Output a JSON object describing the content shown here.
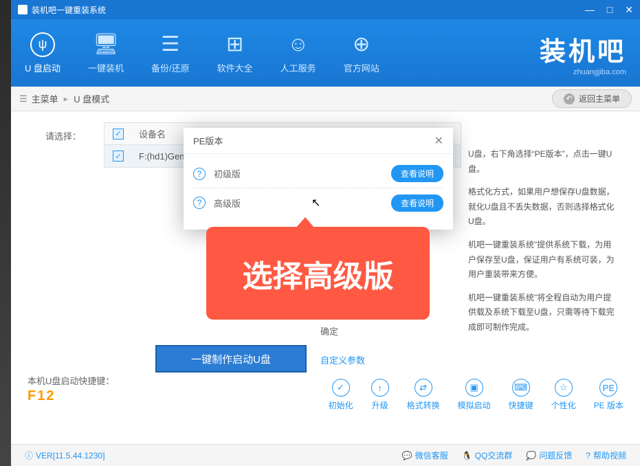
{
  "window": {
    "title": "装机吧一键重装系统"
  },
  "toolbar": {
    "items": [
      {
        "label": "U 盘启动"
      },
      {
        "label": "一键装机"
      },
      {
        "label": "备份/还原"
      },
      {
        "label": "软件大全"
      },
      {
        "label": "人工服务"
      },
      {
        "label": "官方网站"
      }
    ]
  },
  "brand": {
    "text": "装机吧",
    "url": "zhuangjiba.com"
  },
  "breadcrumb": {
    "main": "主菜单",
    "sub": "U 盘模式",
    "back": "返回主菜单"
  },
  "content": {
    "select_label": "请选择：",
    "table_header": "设备名",
    "device_row": "F:(hd1)Genera",
    "info_p1": "U盘，右下角选择“PE版本”，点击一键U盘。",
    "info_p2": "格式化方式，如果用户想保存U盘数据，就化U盘且不丢失数据，否则选择格式化U盘。",
    "info_p3": "机吧一键重装系统\"提供系统下载，为用户保存至U盘，保证用户有系统可装，为用户重装带来方便。",
    "info_p4": "机吧一键重装系统\"将全程自动为用户提供载及系统下载至U盘，只需等待下载完成即可制作完成。",
    "confirm": "确定",
    "make_button": "一键制作启动U盘",
    "custom_link": "自定义参数"
  },
  "modal": {
    "title": "PE版本",
    "option1": "初级版",
    "option2": "高级版",
    "view_btn": "查看说明"
  },
  "callout": {
    "text": "选择高级版"
  },
  "hotkey": {
    "label": "本机U盘启动快捷键：",
    "value": "F12"
  },
  "bottom_tools": {
    "items": [
      {
        "label": "初始化"
      },
      {
        "label": "升级"
      },
      {
        "label": "格式转换"
      },
      {
        "label": "模拟启动"
      },
      {
        "label": "快捷键"
      },
      {
        "label": "个性化"
      },
      {
        "label": "PE 版本"
      }
    ]
  },
  "statusbar": {
    "version": "VER[11.5.44.1230]",
    "links": [
      "微信客服",
      "QQ交流群",
      "问题反馈",
      "帮助视频"
    ]
  }
}
